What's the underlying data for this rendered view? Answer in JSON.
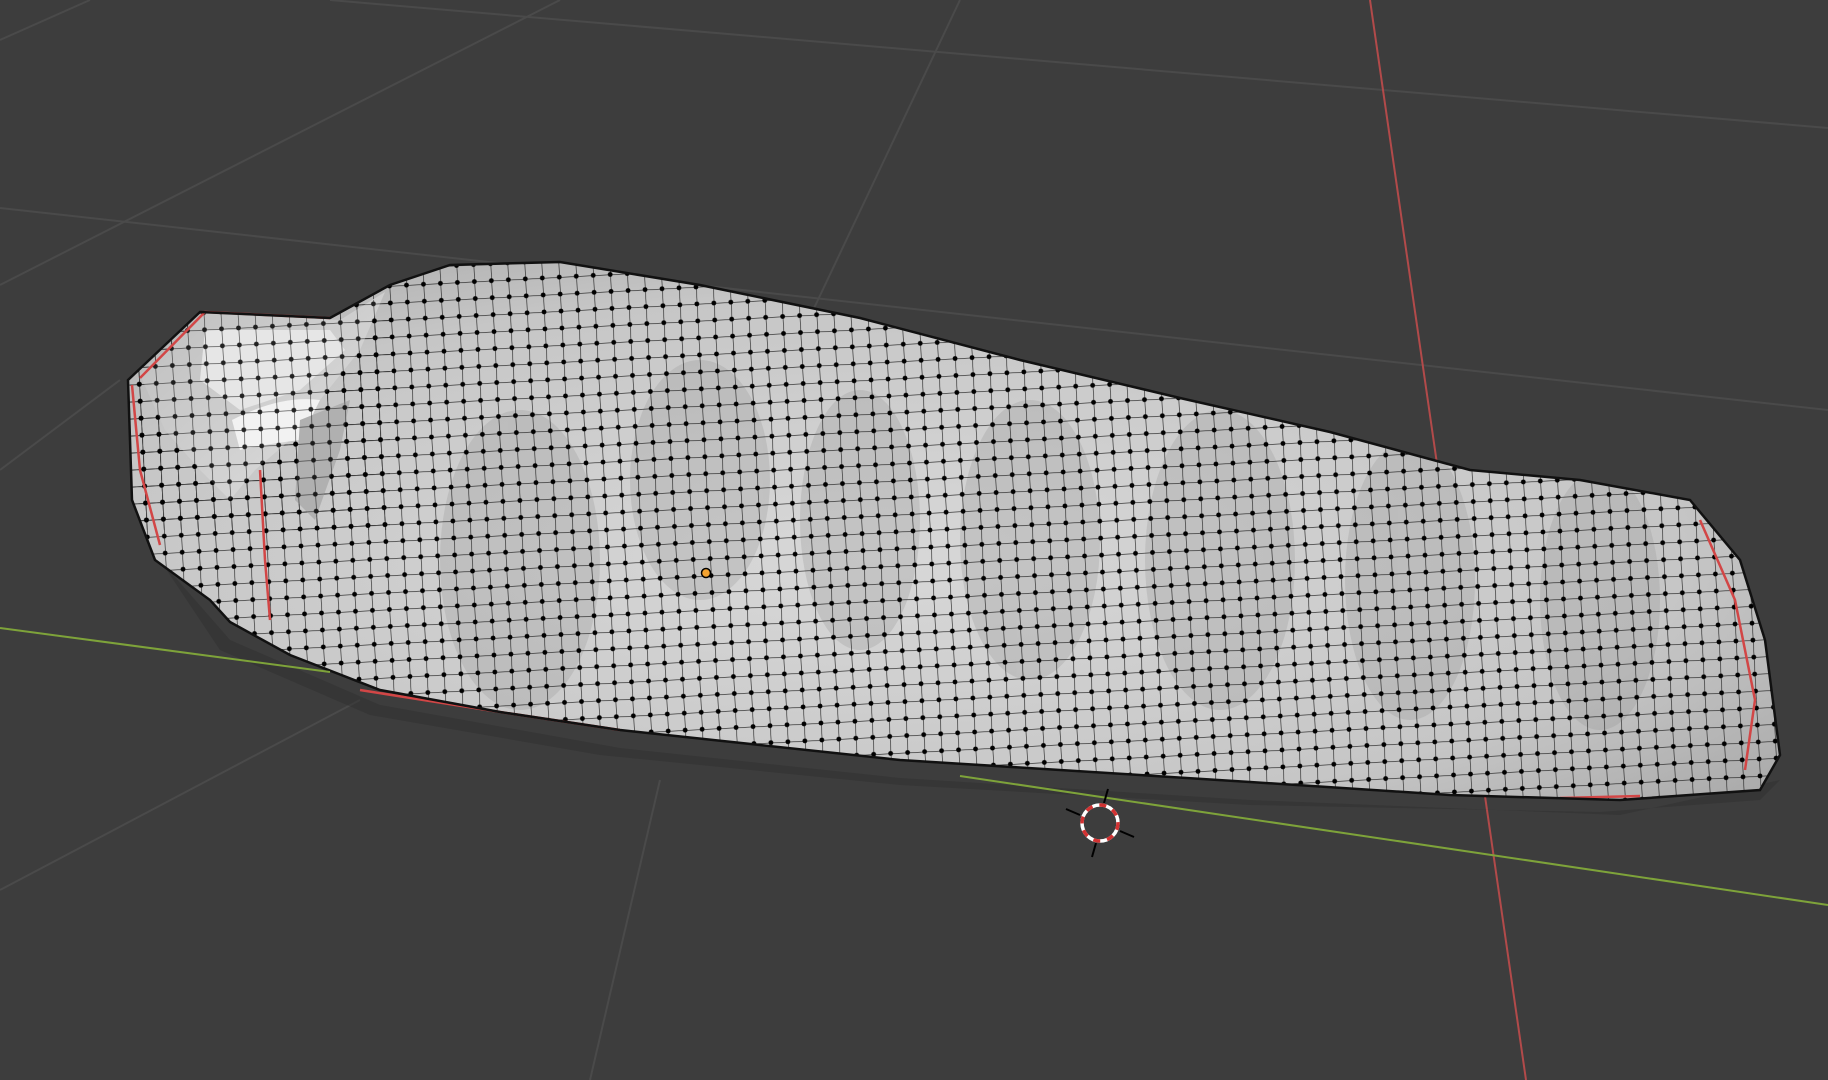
{
  "viewport": {
    "background_color": "#3d3d3d",
    "grid_line_color": "#4a4a4a",
    "x_axis_color": "#7ea33a",
    "y_axis_color": "#b24a4a"
  },
  "mesh": {
    "object": "sleeping-bag",
    "mode": "edit",
    "surface_color": "#cfcfcf",
    "wire_color": "#1a1a1a",
    "vertex_color": "#000000",
    "seam_color": "#d24646"
  },
  "origin": {
    "icon": "object-origin-icon",
    "color": "#f3a230"
  },
  "cursor": {
    "icon": "3d-cursor-icon",
    "ring_colors": [
      "#ffffff",
      "#d23232"
    ]
  }
}
